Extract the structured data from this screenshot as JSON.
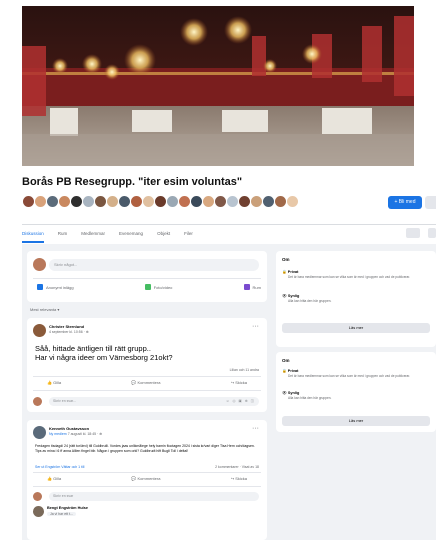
{
  "group": {
    "name": "Borås PB Resegrupp. \"iter esim voluntas\"",
    "join_label": "+ Bli med",
    "member_colors": [
      "#8a4a38",
      "#d9a27a",
      "#5b6b7a",
      "#c9885f",
      "#2e2e2e",
      "#a8b4c0",
      "#7a5640",
      "#d4b08a",
      "#4a5a6a",
      "#b06040",
      "#e0c0a0",
      "#6a3a2a",
      "#9aa8b4",
      "#c07050",
      "#3a4a5a",
      "#d8a880",
      "#805848",
      "#b8c4d0",
      "#704030",
      "#caa07a",
      "#506070",
      "#a06848",
      "#e8c8a8"
    ]
  },
  "tabs": [
    "Diskussion",
    "Rum",
    "Medlemmar",
    "Evenemang",
    "Objekt",
    "Filer"
  ],
  "composer": {
    "placeholder": "Skriv något...",
    "actions": [
      {
        "label": "Anonymt inlägg",
        "color": "#1b74e4"
      },
      {
        "label": "Foto/video",
        "color": "#45bd62"
      },
      {
        "label": "Rum",
        "color": "#7a4bcf"
      }
    ]
  },
  "sort_label": "Mest relevanta ▾",
  "posts": [
    {
      "author": "Christer Sternlund",
      "meta": "4 september kl. 10:56 · ⊕",
      "text": "Såå, hittade äntligen till rätt grupp..\nHar vi några ideer om Värnesborg 21okt?",
      "stats": "Lilian och 11 andra",
      "actions": [
        "Gilla",
        "Kommentera",
        "Skicka"
      ],
      "comment_placeholder": "Skriv en svar...",
      "comment_icons": "☺ ◎ ▣ ⊕ ◫"
    },
    {
      "author": "Kenneth Gustavsson",
      "badge": "Ny medlem",
      "meta": "7 augusti kl. 18:45 · ⊕",
      "text": "Fredagen tisdagdi 24 (rätt tor/ärvi) till Guldbrulli. Vordes jaas unlikmåiege hely bamin flootagen 2024 i sista kr/vari diger Tisa Hem och/dagsen. Tips av mina i 6 ff anna Alllen fingel blir. Någon i gruppen som orkl? Guldbrudt hift Bugli Toll i deltal!",
      "link": "Ser ut Engström Vättar och 1 till",
      "stats": "2 kommentarer · Visat av 18",
      "actions": [
        "Gilla",
        "Kommentera",
        "Skicka"
      ],
      "comment_placeholder": "Skriv en svar",
      "comment_icons": "☺ ◎ ▣ ⊕ ◫"
    }
  ],
  "reply": {
    "author": "Bengt Engström Hulse",
    "text": "Ja vi har ett t..."
  },
  "about_panels": [
    {
      "title": "Om",
      "rows": [
        {
          "label": "Privat",
          "sub": "Det är bara medlemmar som kan se vilka som är med i gruppen och vad de publicerar."
        },
        {
          "label": "Synlig",
          "sub": "Alla kan hitta den här gruppen."
        }
      ],
      "button": "Läs mer"
    },
    {
      "title": "Om",
      "rows": [
        {
          "label": "Privat",
          "sub": "Det är bara medlemmar som kan se vilka som är med i gruppen och vad de publicerar."
        },
        {
          "label": "Synlig",
          "sub": "Alla kan hitta den här gruppen."
        }
      ],
      "button": "Läs mer"
    }
  ]
}
